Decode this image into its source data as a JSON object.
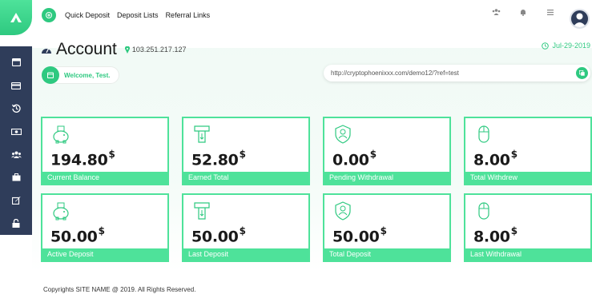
{
  "nav": {
    "links": [
      "Quick Deposit",
      "Deposit Lists",
      "Referral Links"
    ]
  },
  "header": {
    "title": "Account",
    "ip": "103.251.217.127",
    "date": "Jul-29-2019",
    "welcome": "Welcome, Test.",
    "ref_url": "http://cryptophoenixxx.com/demo12/?ref=test"
  },
  "sidebar": {
    "items": [
      "dashboard-icon",
      "card-icon",
      "history-icon",
      "money-icon",
      "users-icon",
      "briefcase-icon",
      "edit-icon",
      "lock-icon"
    ]
  },
  "cards": [
    {
      "value": "194.80",
      "currency": "$",
      "label": "Current Balance",
      "icon": "piggy-bank-icon"
    },
    {
      "value": "52.80",
      "currency": "$",
      "label": "Earned Total",
      "icon": "atm-withdraw-icon"
    },
    {
      "value": "0.00",
      "currency": "$",
      "label": "Pending Withdrawal",
      "icon": "shield-user-icon"
    },
    {
      "value": "8.00",
      "currency": "$",
      "label": "Total Withdrew",
      "icon": "mouse-icon"
    },
    {
      "value": "50.00",
      "currency": "$",
      "label": "Active Deposit",
      "icon": "piggy-bank-icon"
    },
    {
      "value": "50.00",
      "currency": "$",
      "label": "Last Deposit",
      "icon": "atm-withdraw-icon"
    },
    {
      "value": "50.00",
      "currency": "$",
      "label": "Total Deposit",
      "icon": "shield-user-icon"
    },
    {
      "value": "8.00",
      "currency": "$",
      "label": "Last Withdrawal",
      "icon": "mouse-icon"
    }
  ],
  "footer": {
    "text": "Copyrights SITE NAME @ 2019. All Rights Reserved."
  },
  "colors": {
    "accent": "#4ee29a",
    "accent_dark": "#2ec980",
    "sidebar": "#2f3d5a"
  }
}
